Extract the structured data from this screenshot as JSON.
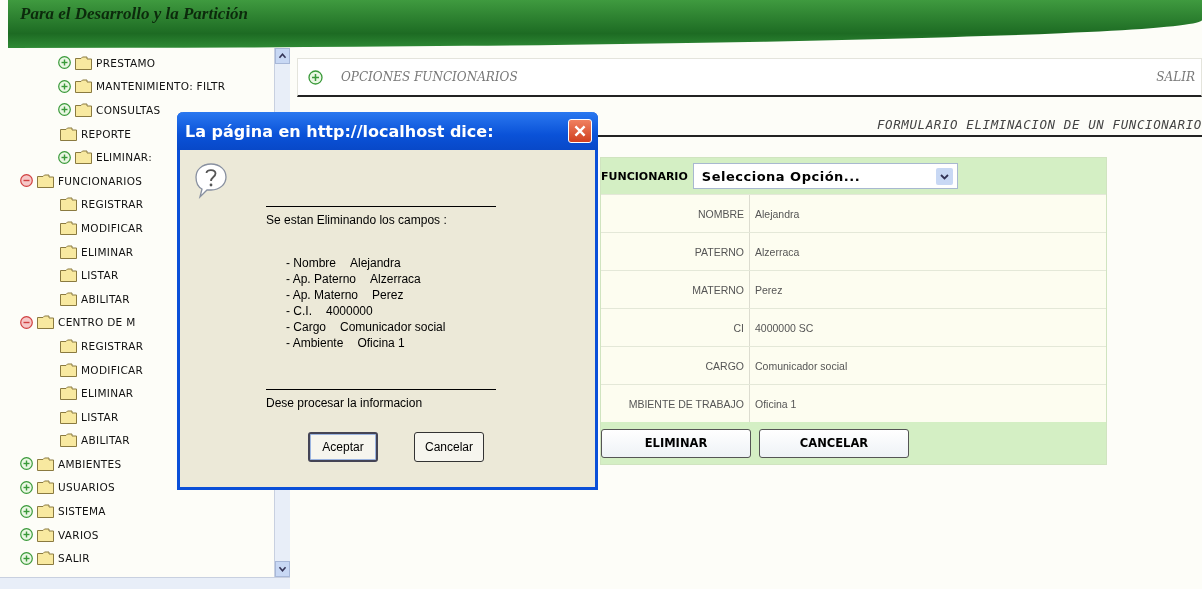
{
  "header": {
    "title": "Para el Desarrollo y la Partición"
  },
  "sidebar": {
    "continued_items": [
      {
        "label": "PRESTAMO",
        "kind": "node",
        "expanded": false
      },
      {
        "label": "MANTENIMIENTO: FILTR",
        "kind": "node",
        "expanded": false
      },
      {
        "label": "CONSULTAS",
        "kind": "node",
        "expanded": false
      },
      {
        "label": "REPORTE",
        "kind": "leaf"
      },
      {
        "label": "ELIMINAR:",
        "kind": "node",
        "expanded": false
      }
    ],
    "items": [
      {
        "label": "FUNCIONARIOS",
        "kind": "node",
        "expanded": true,
        "children": [
          {
            "label": "REGISTRAR",
            "kind": "leaf"
          },
          {
            "label": "MODIFICAR",
            "kind": "leaf"
          },
          {
            "label": "ELIMINAR",
            "kind": "leaf"
          },
          {
            "label": "LISTAR",
            "kind": "leaf"
          },
          {
            "label": "ABILITAR",
            "kind": "leaf"
          }
        ]
      },
      {
        "label": "CENTRO DE M",
        "kind": "node",
        "expanded": true,
        "children": [
          {
            "label": "REGISTRAR",
            "kind": "leaf"
          },
          {
            "label": "MODIFICAR",
            "kind": "leaf"
          },
          {
            "label": "ELIMINAR",
            "kind": "leaf"
          },
          {
            "label": "LISTAR",
            "kind": "leaf"
          },
          {
            "label": "ABILITAR",
            "kind": "leaf"
          }
        ]
      },
      {
        "label": "AMBIENTES",
        "kind": "node",
        "expanded": false
      },
      {
        "label": "USUARIOS",
        "kind": "node",
        "expanded": false
      },
      {
        "label": "SISTEMA",
        "kind": "node",
        "expanded": false
      },
      {
        "label": "VARIOS",
        "kind": "node",
        "expanded": false
      },
      {
        "label": "SALIR",
        "kind": "node",
        "expanded": false
      }
    ]
  },
  "options_bar": {
    "title": "OPCIONES FUNCIONARIOS",
    "exit": "SALIR"
  },
  "form_title": "FORMULARIO ELIMINACION DE UN FUNCIONARIO",
  "form": {
    "select_label": "FUNCIONARIO",
    "select_value": "Selecciona Opción...",
    "rows": [
      {
        "label": "NOMBRE",
        "value": "Alejandra"
      },
      {
        "label": "PATERNO",
        "value": "Alzerraca"
      },
      {
        "label": "MATERNO",
        "value": "Perez"
      },
      {
        "label": "CI",
        "value": "4000000 SC"
      },
      {
        "label": "CARGO",
        "value": "Comunicador social"
      },
      {
        "label": "MBIENTE DE TRABAJO",
        "value": "Oficina 1"
      }
    ],
    "buttons": [
      "ELIMINAR",
      "CANCELAR"
    ]
  },
  "dialog": {
    "title": "La página en http://localhost dice:",
    "message": "Se estan Eliminando los campos :",
    "fields": [
      {
        "label": "- Nombre",
        "value": "Alejandra"
      },
      {
        "label": "- Ap. Paterno",
        "value": "Alzerraca"
      },
      {
        "label": "- Ap. Materno",
        "value": "Perez"
      },
      {
        "label": "- C.I.",
        "value": "4000000"
      },
      {
        "label": "- Cargo",
        "value": "Comunicador social"
      },
      {
        "label": "- Ambiente",
        "value": "Oficina 1"
      }
    ],
    "question": "Dese procesar la informacion",
    "buttons": [
      {
        "label": "Aceptar",
        "selected": true
      },
      {
        "label": "Cancelar",
        "selected": false
      }
    ]
  }
}
